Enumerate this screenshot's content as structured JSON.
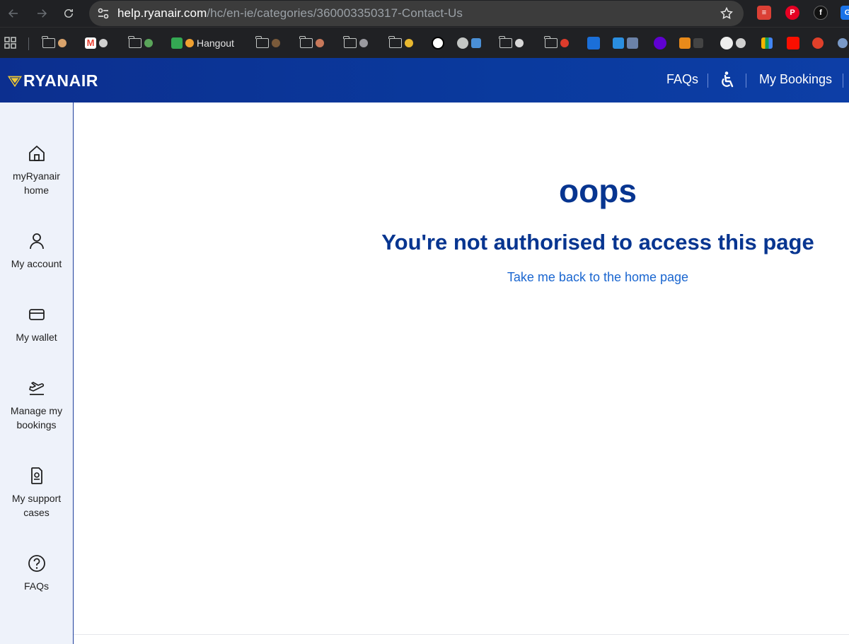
{
  "browser": {
    "url_host": "help.ryanair.com",
    "url_path": "/hc/en-ie/categories/360003350317-Contact-Us",
    "bookmarks": [
      {
        "label": "Hangout"
      }
    ]
  },
  "header": {
    "logo": "RYANAIR",
    "faqs": "FAQs",
    "my_bookings": "My Bookings"
  },
  "sidebar": {
    "items": [
      {
        "label_line1": "myRyanair",
        "label_line2": "home",
        "icon": "home-icon"
      },
      {
        "label_line1": "My account",
        "label_line2": "",
        "icon": "user-icon"
      },
      {
        "label_line1": "My wallet",
        "label_line2": "",
        "icon": "wallet-icon"
      },
      {
        "label_line1": "Manage my",
        "label_line2": "bookings",
        "icon": "plane-takeoff-icon"
      },
      {
        "label_line1": "My support",
        "label_line2": "cases",
        "icon": "document-icon"
      },
      {
        "label_line1": "FAQs",
        "label_line2": "",
        "icon": "question-icon"
      }
    ]
  },
  "main": {
    "heading": "oops",
    "message": "You're not authorised to access this page",
    "link": "Take me back to the home page"
  },
  "colors": {
    "brand_blue": "#073590",
    "header_blue": "#0c2f8f",
    "link_blue": "#1a66d0",
    "sidebar_bg": "#eef2fa",
    "logo_yellow": "#f1c933"
  }
}
